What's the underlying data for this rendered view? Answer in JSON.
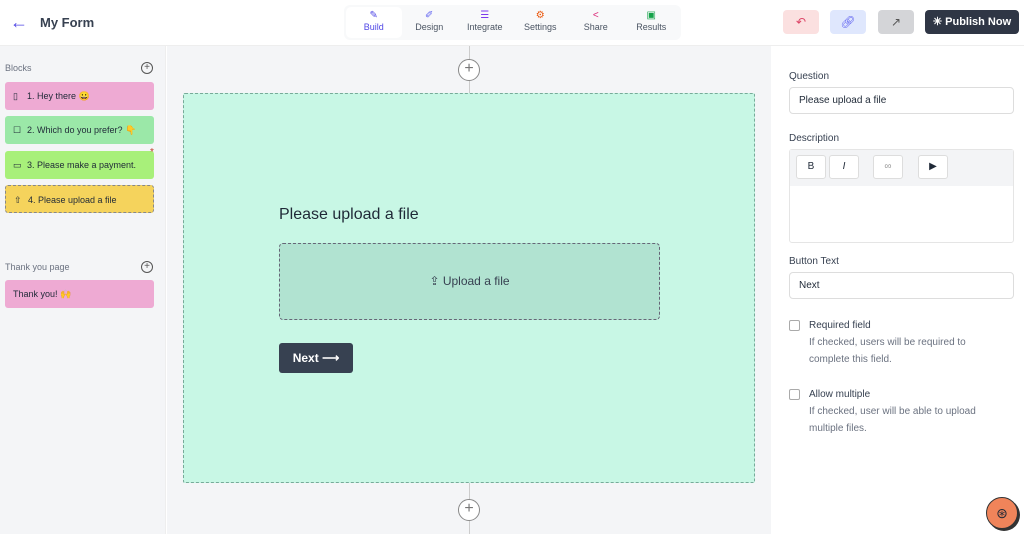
{
  "header": {
    "title": "My Form",
    "publish_label": "Publish Now",
    "tabs": [
      {
        "label": "Build",
        "icon": "brush-icon"
      },
      {
        "label": "Design",
        "icon": "pen-icon"
      },
      {
        "label": "Integrate",
        "icon": "sliders-icon"
      },
      {
        "label": "Settings",
        "icon": "gear-icon"
      },
      {
        "label": "Share",
        "icon": "share-icon"
      },
      {
        "label": "Results",
        "icon": "chart-icon"
      }
    ]
  },
  "sidebar": {
    "blocks_label": "Blocks",
    "thankyou_label": "Thank you page",
    "blocks": [
      {
        "label": "1. Hey there 😀",
        "color": "#eeaad3"
      },
      {
        "label": "2. Which do you prefer? 👇",
        "color": "#9be8a8"
      },
      {
        "label": "3. Please make a payment.",
        "color": "#a8f07a"
      },
      {
        "label": "4. Please upload a file",
        "color": "#f5d35c"
      }
    ],
    "thankyou": [
      {
        "label": "Thank you! 🙌",
        "color": "#eeaad3"
      }
    ]
  },
  "canvas": {
    "question": "Please upload a file",
    "upload_label": "Upload a file",
    "next_label": "Next"
  },
  "panel": {
    "question_label": "Question",
    "question_value": "Please upload a file",
    "description_label": "Description",
    "button_text_label": "Button Text",
    "button_text_value": "Next",
    "required_label": "Required field",
    "required_desc": "If checked, users will be required to complete this field.",
    "multiple_label": "Allow multiple",
    "multiple_desc": "If checked, user will be able to upload multiple files."
  }
}
